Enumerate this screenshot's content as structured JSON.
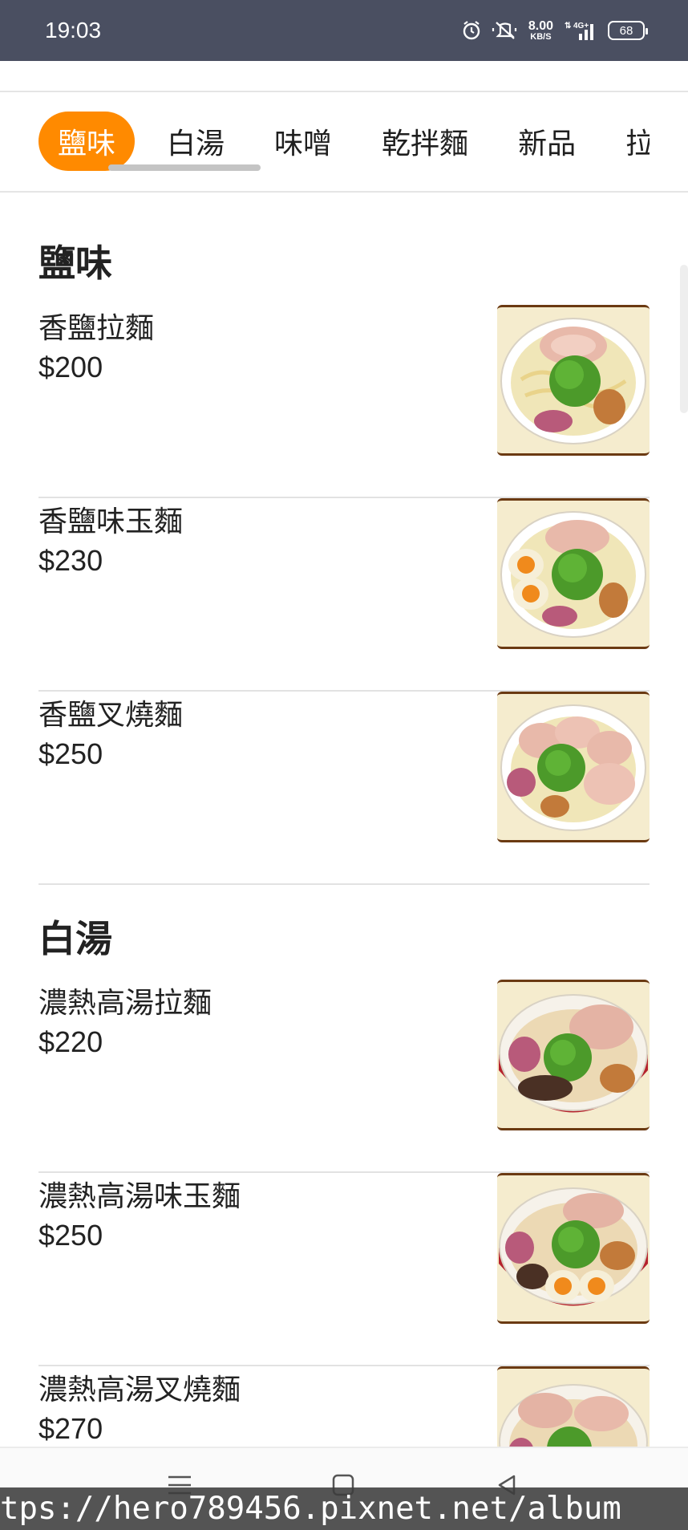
{
  "status_bar": {
    "time": "19:03",
    "net_speed_value": "8.00",
    "net_speed_unit": "KB/S",
    "network": "4G",
    "battery": "68",
    "icons": [
      "alarm-icon",
      "mute-icon",
      "signal-icon"
    ]
  },
  "tabs": [
    {
      "label": "鹽味",
      "active": true
    },
    {
      "label": "白湯",
      "active": false
    },
    {
      "label": "味噌",
      "active": false
    },
    {
      "label": "乾拌麵",
      "active": false
    },
    {
      "label": "新品",
      "active": false
    },
    {
      "label": "拉",
      "active": false
    }
  ],
  "sections": [
    {
      "title": "鹽味",
      "items": [
        {
          "name": "香鹽拉麵",
          "price": "$200"
        },
        {
          "name": "香鹽味玉麵",
          "price": "$230"
        },
        {
          "name": "香鹽叉燒麵",
          "price": "$250"
        }
      ]
    },
    {
      "title": "白湯",
      "items": [
        {
          "name": "濃熱高湯拉麵",
          "price": "$220"
        },
        {
          "name": "濃熱高湯味玉麵",
          "price": "$250"
        },
        {
          "name": "濃熱高湯叉燒麵",
          "price": "$270"
        }
      ]
    }
  ],
  "watermark": "tps://hero789456.pixnet.net/album",
  "colors": {
    "accent": "#ff8a00",
    "status_bar": "#4a4f61"
  }
}
